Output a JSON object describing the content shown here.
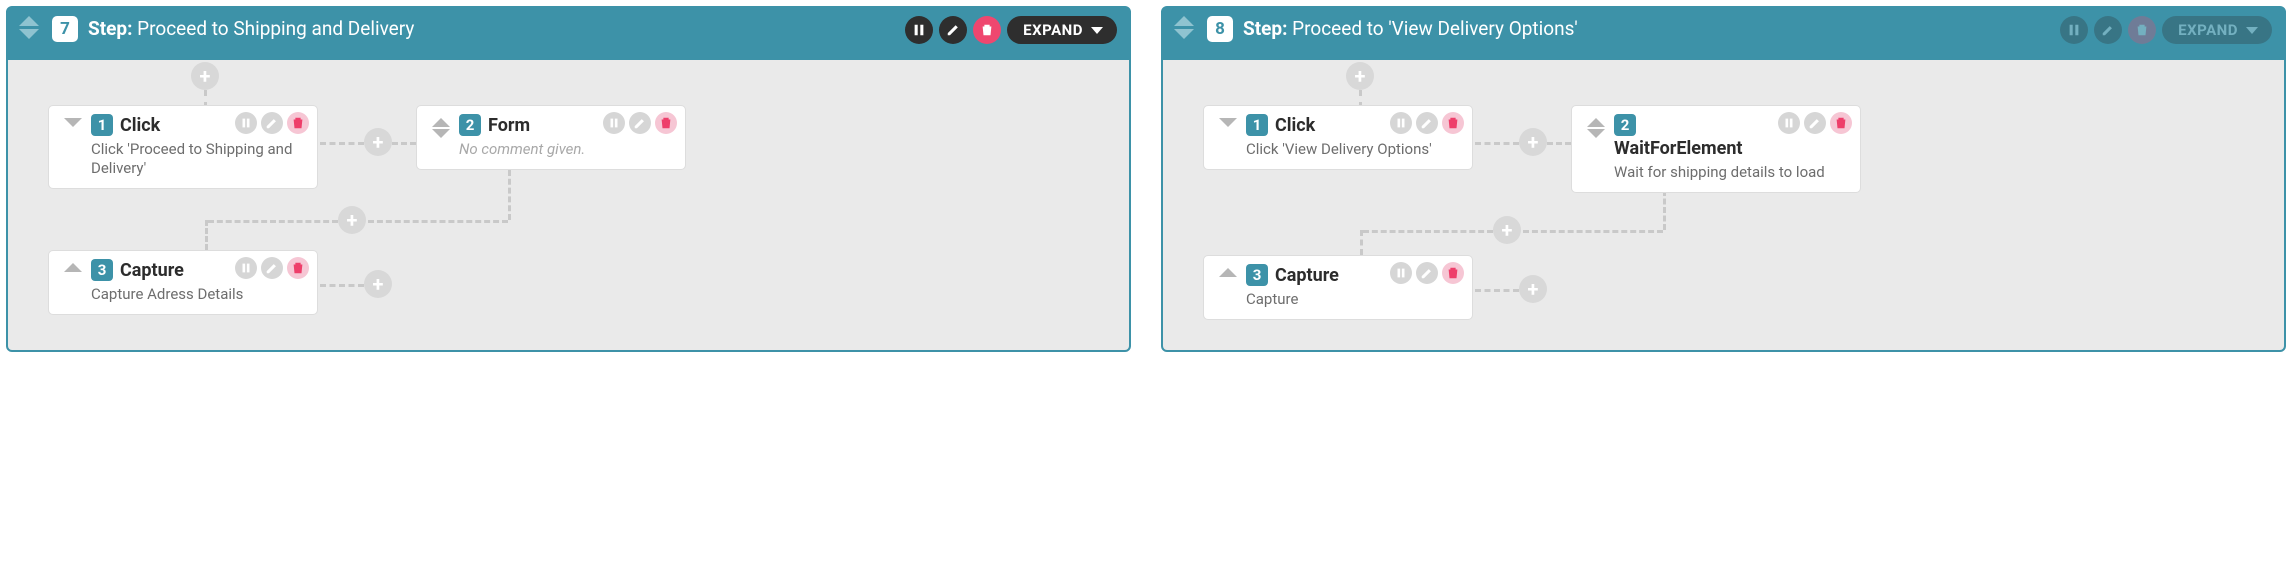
{
  "expand_label": "EXPAND",
  "no_comment": "No comment given.",
  "panels": [
    {
      "number": "7",
      "label_prefix": "Step:",
      "title": "Proceed to Shipping and Delivery",
      "actions_enabled": true,
      "cards": {
        "c1": {
          "num": "1",
          "name": "Click",
          "desc": "Click 'Proceed to Shipping and Delivery'"
        },
        "c2": {
          "num": "2",
          "name": "Form"
        },
        "c3": {
          "num": "3",
          "name": "Capture",
          "desc": "Capture Adress Details"
        }
      }
    },
    {
      "number": "8",
      "label_prefix": "Step:",
      "title": "Proceed to 'View Delivery Options'",
      "actions_enabled": false,
      "cards": {
        "c1": {
          "num": "1",
          "name": "Click",
          "desc": "Click 'View Delivery Options'"
        },
        "c2": {
          "num": "2",
          "name": "WaitForElement",
          "desc": "Wait for shipping details to load"
        },
        "c3": {
          "num": "3",
          "name": "Capture",
          "desc": "Capture"
        }
      }
    }
  ]
}
